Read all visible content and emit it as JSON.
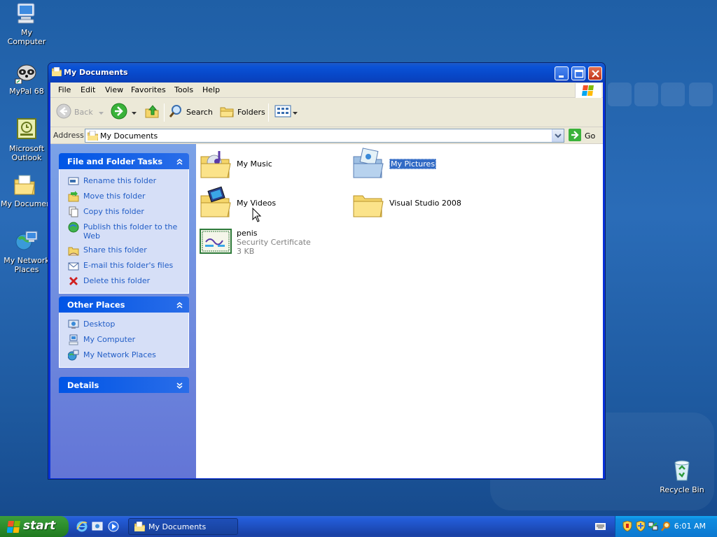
{
  "desktop": {
    "icons": [
      {
        "label": "My Computer"
      },
      {
        "label": "MyPal 68"
      },
      {
        "label_line1": "Microsoft",
        "label_line2": "Outlook"
      },
      {
        "label": "My Documents"
      },
      {
        "label_line1": "My Network",
        "label_line2": "Places"
      },
      {
        "label": "Recycle Bin"
      }
    ]
  },
  "window": {
    "title": "My Documents",
    "menu": [
      "File",
      "Edit",
      "View",
      "Favorites",
      "Tools",
      "Help"
    ],
    "toolbar": {
      "back_label": "Back",
      "search_label": "Search",
      "folders_label": "Folders"
    },
    "address": {
      "label": "Address",
      "value": "My Documents",
      "go_label": "Go"
    }
  },
  "taskpane": {
    "file_tasks": {
      "title": "File and Folder Tasks",
      "items": [
        {
          "label": "Rename this folder",
          "icon": "rename-icon"
        },
        {
          "label": "Move this folder",
          "icon": "move-icon"
        },
        {
          "label": "Copy this folder",
          "icon": "copy-icon"
        },
        {
          "label_line1": "Publish this folder to the",
          "label_line2": "Web",
          "icon": "publish-icon"
        },
        {
          "label": "Share this folder",
          "icon": "share-icon"
        },
        {
          "label": "E-mail this folder's files",
          "icon": "email-icon"
        },
        {
          "label": "Delete this folder",
          "icon": "delete-icon"
        }
      ]
    },
    "other_places": {
      "title": "Other Places",
      "items": [
        {
          "label": "Desktop",
          "icon": "desktop-icon"
        },
        {
          "label": "My Computer",
          "icon": "my-computer-icon"
        },
        {
          "label": "My Network Places",
          "icon": "network-places-icon"
        }
      ]
    },
    "details": {
      "title": "Details"
    }
  },
  "files": [
    {
      "name": "My Music",
      "icon": "music-folder-icon"
    },
    {
      "name": "My Pictures",
      "icon": "pictures-folder-icon",
      "selected": true
    },
    {
      "name": "My Videos",
      "icon": "videos-folder-icon"
    },
    {
      "name": "Visual Studio 2008",
      "icon": "folder-icon"
    },
    {
      "name": "penis",
      "type": "Security Certificate",
      "size": "3 KB",
      "icon": "certificate-icon"
    }
  ],
  "taskbar": {
    "start_label": "start",
    "task_button_label": "My Documents",
    "clock": "6:01 AM"
  },
  "colors": {
    "titlebar": "#0a52d6",
    "link": "#215dc6",
    "selection": "#316ac5",
    "start_green": "#2f912f"
  }
}
